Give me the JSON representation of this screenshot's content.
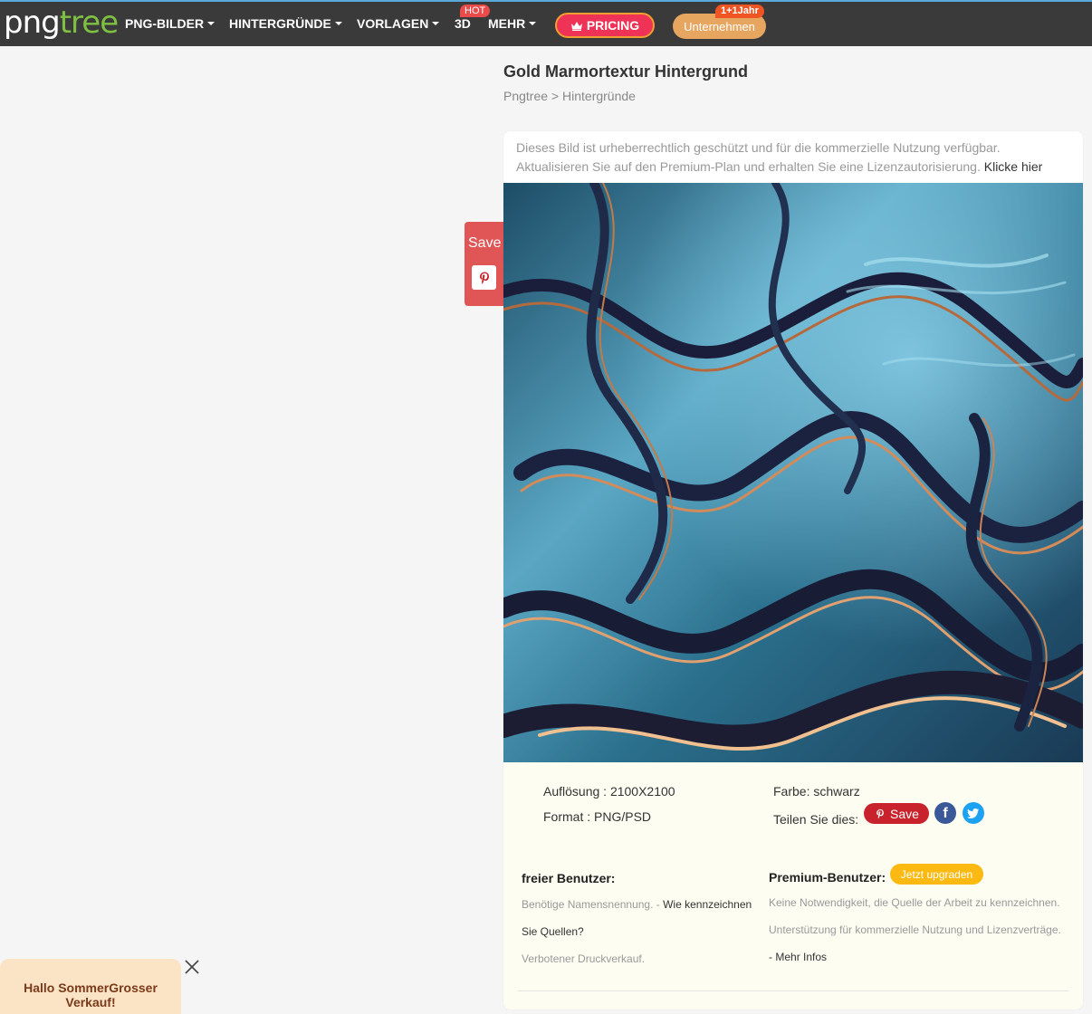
{
  "nav": {
    "logo_part1": "png",
    "logo_part2": "tree",
    "items": [
      "PNG-BILDER",
      "HINTERGRÜNDE",
      "VORLAGEN",
      "3D",
      "MEHR"
    ],
    "hot_badge": "HOT",
    "pricing": "PRICING",
    "business": "Unternehmen",
    "business_badge": "1+1Jahr"
  },
  "page": {
    "title": "Gold Marmortextur Hintergrund",
    "breadcrumb_home": "Pngtree",
    "breadcrumb_sep": " > ",
    "breadcrumb_current": "Hintergründe"
  },
  "notice": {
    "text": "Dieses Bild ist urheberrechtlich geschützt und für die kommerzielle Nutzung verfügbar. Aktualisieren Sie auf den Premium-Plan und erhalten Sie eine Lizenzautorisierung.",
    "link": "Klicke hier"
  },
  "details": {
    "resolution": "Auflösung : 2100X2100",
    "format": "Format : PNG/PSD",
    "color": "Farbe: schwarz",
    "share_label": "Teilen Sie dies:",
    "save": "Save"
  },
  "free_user": {
    "title": "freier Benutzer:",
    "line1_gray": "Benötige Namensnennung. - ",
    "line1_link": "Wie kennzeichnen",
    "line2_link": "Sie Quellen?",
    "line3": "Verbotener Druckverkauf."
  },
  "premium_user": {
    "title": "Premium-Benutzer:",
    "upgrade": "Jetzt upgraden",
    "line1": "Keine Notwendigkeit, die Quelle der Arbeit zu kennzeichnen.",
    "line2": "Unterstützung für kommerzielle Nutzung und Lizenzverträge.",
    "more_prefix": "- ",
    "more_link": "Mehr Infos"
  },
  "side_save": {
    "label": "Save"
  },
  "promo": {
    "text": "Hallo SommerGrosser Verkauf!"
  },
  "colors": {
    "nav_bg": "#3a3a3a",
    "pricing": "#ee3357",
    "upgrade": "#fbb911",
    "save_red": "#c8232c"
  }
}
